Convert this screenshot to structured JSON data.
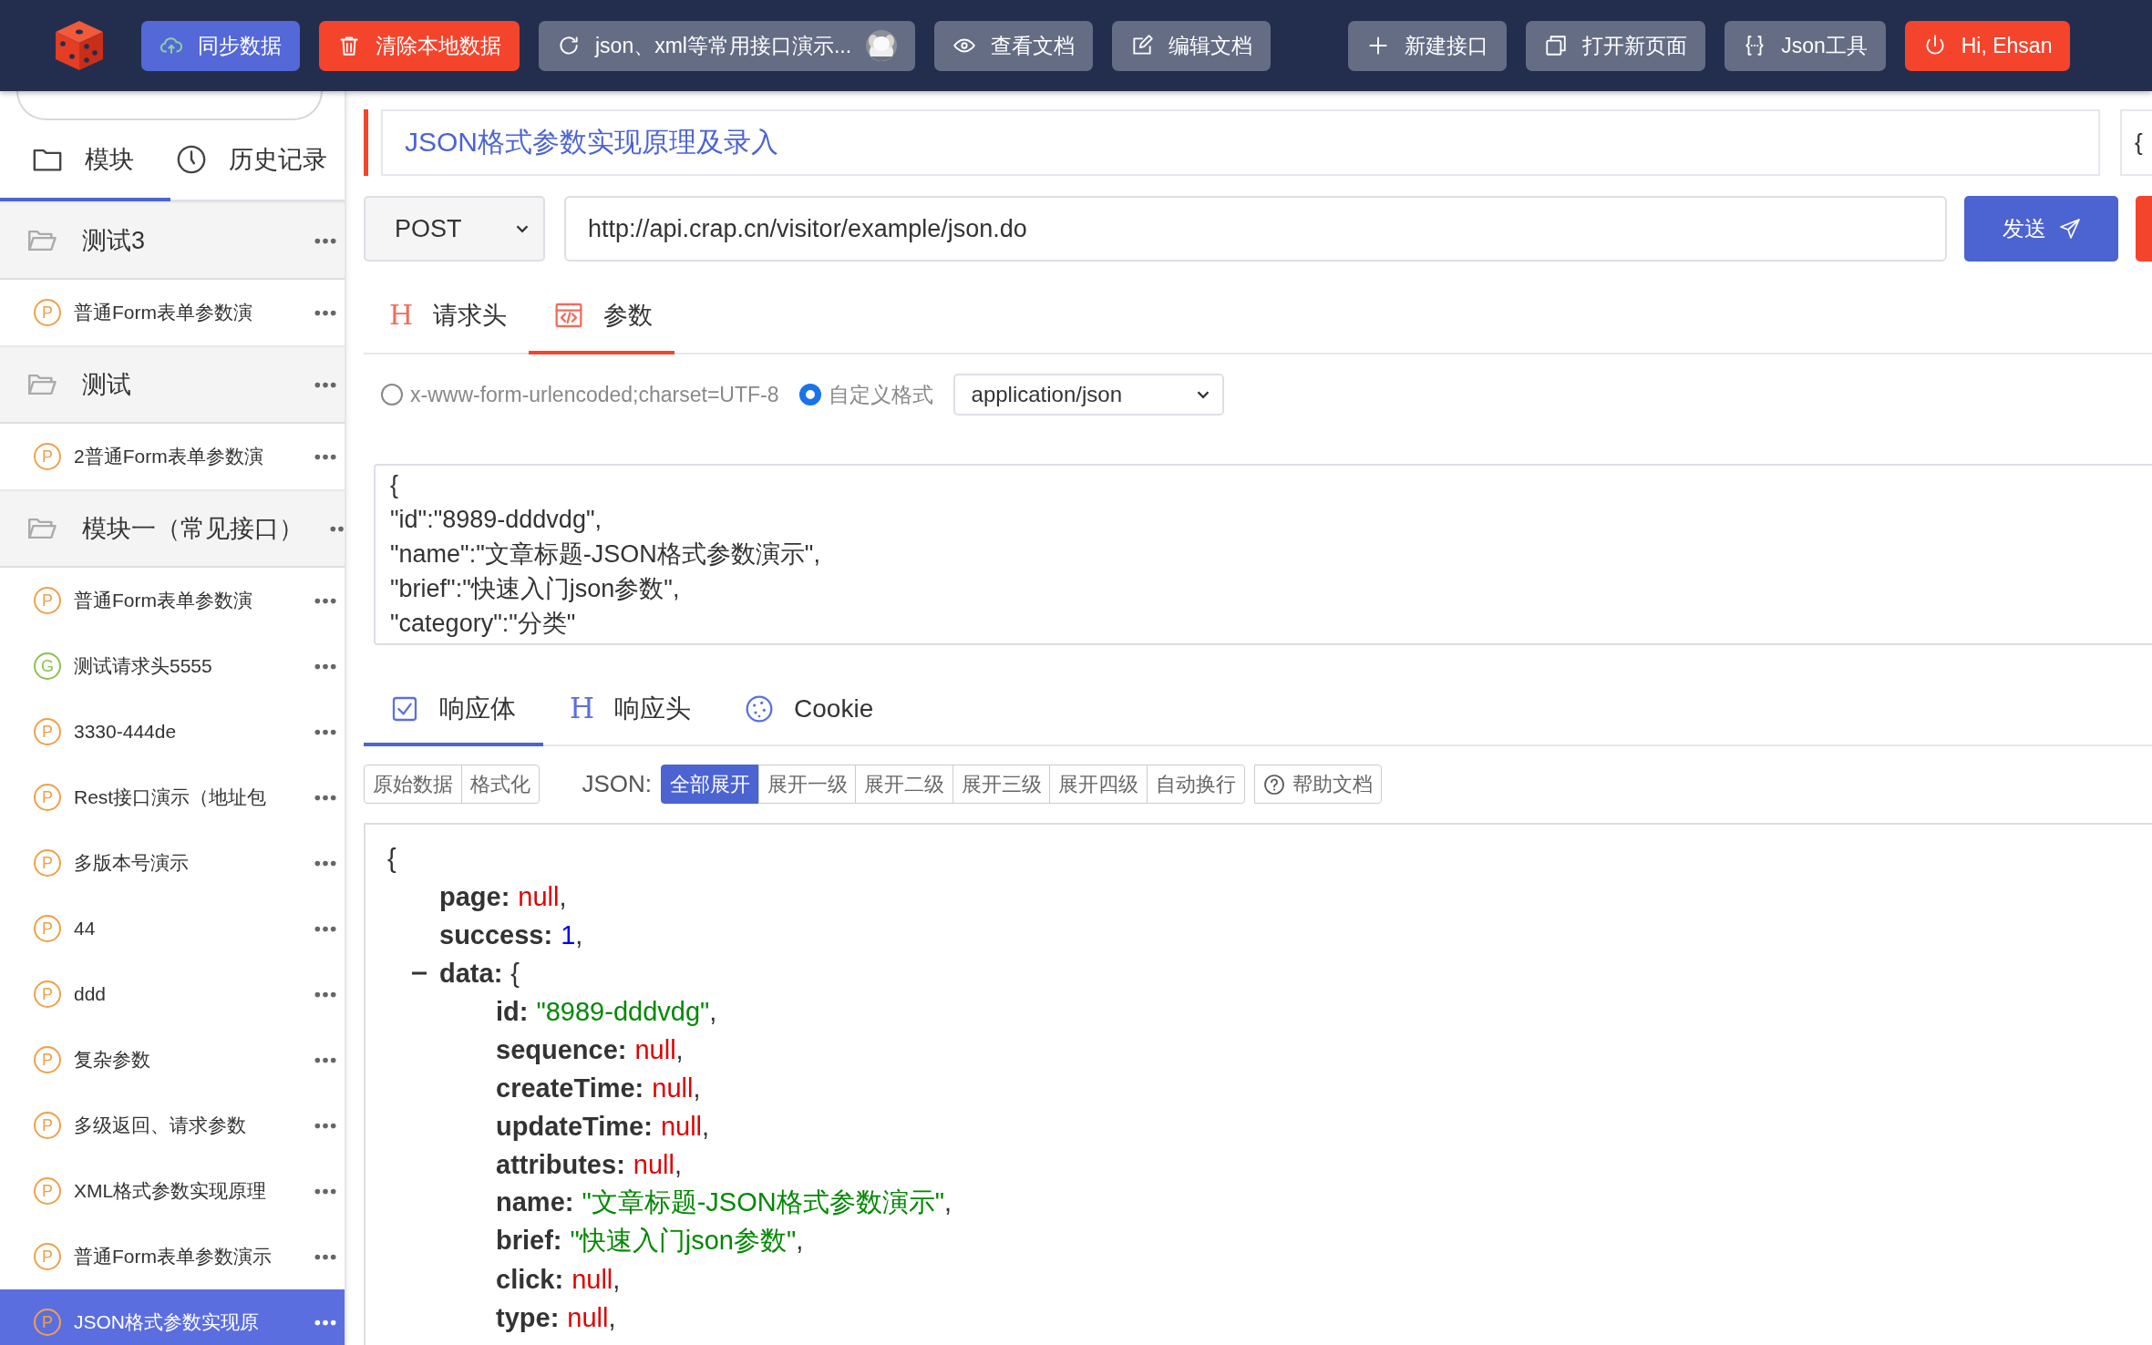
{
  "topbar": {
    "left_buttons": [
      {
        "label": "同步数据"
      },
      {
        "label": "清除本地数据"
      },
      {
        "label": "json、xml等常用接口演示...",
        "avatar": true
      },
      {
        "label": "查看文档"
      },
      {
        "label": "编辑文档"
      }
    ],
    "right_buttons": [
      {
        "label": "新建接口"
      },
      {
        "label": "打开新页面"
      },
      {
        "label": "Json工具"
      },
      {
        "label": "Hi, Ehsan"
      }
    ]
  },
  "sidebar": {
    "tabs": [
      {
        "label": "模块",
        "selected": true
      },
      {
        "label": "历史记录",
        "selected": false
      }
    ],
    "tree": [
      {
        "name": "测试3",
        "children": [
          {
            "method": "P",
            "color": "#f0a04b",
            "name": "普通Form表单参数演",
            "selected": false
          }
        ]
      },
      {
        "name": "测试",
        "children": [
          {
            "method": "P",
            "color": "#f0a04b",
            "name": "2普通Form表单参数演",
            "selected": false
          }
        ]
      },
      {
        "name": "模块一（常见接口）",
        "children": [
          {
            "method": "P",
            "color": "#f0a04b",
            "name": "普通Form表单参数演",
            "selected": false
          },
          {
            "method": "G",
            "color": "#8cc152",
            "name": "测试请求头5555",
            "selected": false
          },
          {
            "method": "P",
            "color": "#f0a04b",
            "name": "3330-444de",
            "selected": false
          },
          {
            "method": "P",
            "color": "#f0a04b",
            "name": "Rest接口演示（地址包",
            "selected": false
          },
          {
            "method": "P",
            "color": "#f0a04b",
            "name": "多版本号演示",
            "selected": false
          },
          {
            "method": "P",
            "color": "#f0a04b",
            "name": "44",
            "selected": false
          },
          {
            "method": "P",
            "color": "#f0a04b",
            "name": "ddd",
            "selected": false
          },
          {
            "method": "P",
            "color": "#f0a04b",
            "name": "复杂参数",
            "selected": false
          },
          {
            "method": "P",
            "color": "#f0a04b",
            "name": "多级返回、请求参数",
            "selected": false
          },
          {
            "method": "P",
            "color": "#f0a04b",
            "name": "XML格式参数实现原理",
            "selected": false
          },
          {
            "method": "P",
            "color": "#f0a04b",
            "name": "普通Form表单参数演示",
            "selected": false
          },
          {
            "method": "P",
            "color": "#f0a04b",
            "name": "JSON格式参数实现原",
            "selected": true
          }
        ]
      }
    ]
  },
  "request": {
    "title": "JSON格式参数实现原理及录入",
    "side_box": "{",
    "method": "POST",
    "url": "http://api.crap.cn/visitor/example/json.do",
    "send": "发送",
    "tabs": [
      {
        "glyph": "H",
        "label": "请求头",
        "selected": false
      },
      {
        "label": "参数",
        "selected": true
      }
    ],
    "formats": [
      {
        "label": "x-www-form-urlencoded;charset=UTF-8",
        "selected": false
      },
      {
        "label": "自定义格式",
        "selected": true
      }
    ],
    "content_type": "application/json",
    "body_lines": [
      "{",
      "\"id\":\"8989-dddvdg\",",
      "\"name\":\"文章标题-JSON格式参数演示\",",
      "\"brief\":\"快速入门json参数\",",
      "\"category\":\"分类\""
    ]
  },
  "response": {
    "tabs": [
      {
        "label": "响应体",
        "selected": true
      },
      {
        "glyph": "H",
        "label": "响应头",
        "selected": false
      },
      {
        "label": "Cookie",
        "selected": false
      }
    ],
    "view_modes": [
      {
        "label": "原始数据",
        "selected": false
      },
      {
        "label": "格式化",
        "selected": false
      }
    ],
    "json_label": "JSON:",
    "expand_options": [
      {
        "label": "全部展开",
        "selected": true
      },
      {
        "label": "展开一级",
        "selected": false
      },
      {
        "label": "展开二级",
        "selected": false
      },
      {
        "label": "展开三级",
        "selected": false
      },
      {
        "label": "展开四级",
        "selected": false
      },
      {
        "label": "自动换行",
        "selected": false
      }
    ],
    "help": "帮助文档",
    "viewer": {
      "open": "{",
      "entries": [
        {
          "key": "page:",
          "value": "null",
          "kind": "null",
          "end": ","
        },
        {
          "key": "success:",
          "value": "1",
          "kind": "number",
          "end": ","
        },
        {
          "key": "data:",
          "value": "{",
          "kind": "object",
          "expanded": true,
          "children": [
            {
              "key": "id:",
              "value": "\"8989-dddvdg\"",
              "kind": "string",
              "end": ","
            },
            {
              "key": "sequence:",
              "value": "null",
              "kind": "null",
              "end": ","
            },
            {
              "key": "createTime:",
              "value": "null",
              "kind": "null",
              "end": ","
            },
            {
              "key": "updateTime:",
              "value": "null",
              "kind": "null",
              "end": ","
            },
            {
              "key": "attributes:",
              "value": "null",
              "kind": "null",
              "end": ","
            },
            {
              "key": "name:",
              "value": "\"文章标题-JSON格式参数演示\"",
              "kind": "string",
              "end": ","
            },
            {
              "key": "brief:",
              "value": "\"快速入门json参数\"",
              "kind": "string",
              "end": ","
            },
            {
              "key": "click:",
              "value": "null",
              "kind": "null",
              "end": ","
            },
            {
              "key": "type:",
              "value": "null",
              "kind": "null",
              "end": ","
            }
          ]
        }
      ]
    }
  }
}
